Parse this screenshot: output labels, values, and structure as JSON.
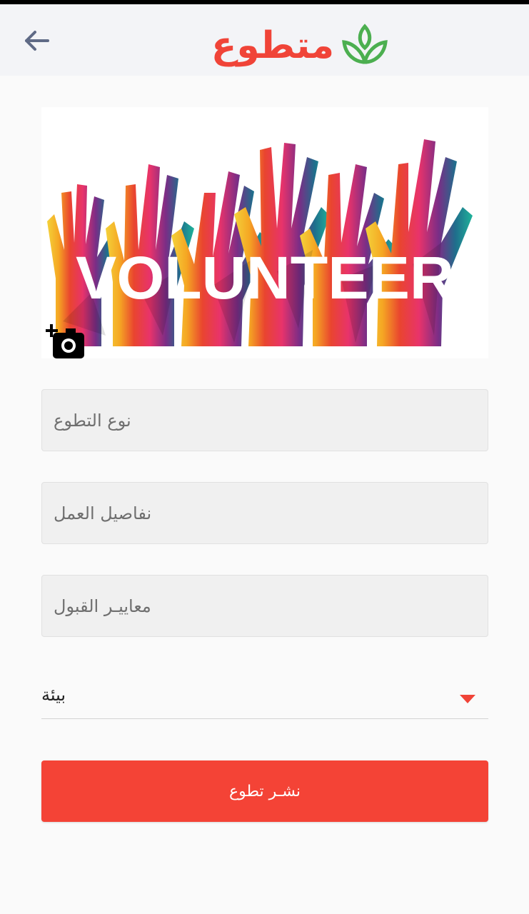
{
  "header": {
    "app_name": "متطوع",
    "back_icon": "arrow-left-icon",
    "logo_icon": "sprout-leaf-icon"
  },
  "banner": {
    "image_text": "VOLUNTEER",
    "add_photo_icon": "add-photo-camera-icon"
  },
  "form": {
    "volunteer_type_placeholder": "نوع التطوع",
    "work_details_placeholder": "نفاصيل العمل",
    "acceptance_criteria_placeholder": "معاييـر القبول",
    "category_selected": "بيئة",
    "submit_label": "نشـر تطوع"
  },
  "colors": {
    "accent": "#f44336",
    "logo_red": "#f04438",
    "logo_green": "#4caf50",
    "back_arrow": "#5f6a86"
  }
}
